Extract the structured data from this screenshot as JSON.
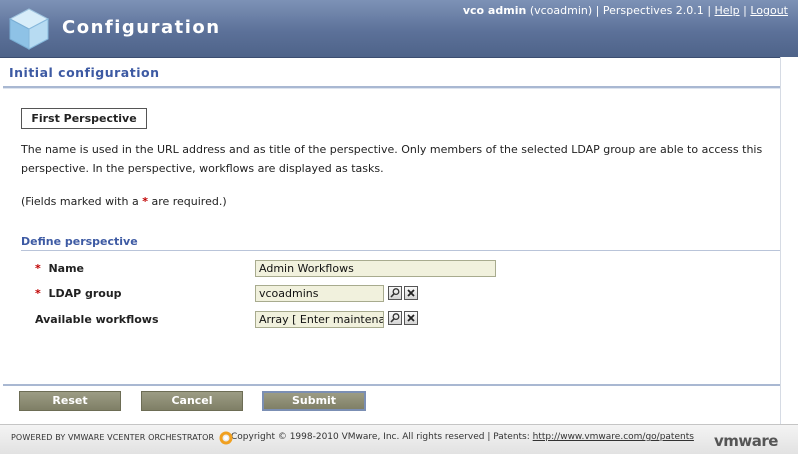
{
  "header": {
    "app_title": "Configuration",
    "user_display": "vco admin",
    "user_id": "(vcoadmin)",
    "separator": "|",
    "version_text": "Perspectives 2.0.1",
    "help_link": "Help",
    "logout_link": "Logout"
  },
  "section": {
    "title": "Initial configuration"
  },
  "tab": {
    "label": "First Perspective"
  },
  "description": "The name is used in the URL address and as title of the perspective. Only members of the selected LDAP group are able to access this perspective. In the perspective, workflows are displayed as tasks.",
  "required_note": {
    "prefix": "(Fields marked with a ",
    "star": "*",
    "suffix": " are required.)"
  },
  "define_perspective": {
    "title": "Define perspective",
    "fields": {
      "name": {
        "required_star": "*",
        "label": "Name",
        "value": "Admin Workflows"
      },
      "ldap_group": {
        "required_star": "*",
        "label": "LDAP group",
        "value": "vcoadmins"
      },
      "workflows": {
        "label": "Available workflows",
        "value": "Array [ Enter maintenance"
      }
    }
  },
  "buttons": {
    "reset": "Reset",
    "cancel": "Cancel",
    "submit": "Submit"
  },
  "footer": {
    "powered_by": "POWERED BY VMWARE VCENTER ORCHESTRATOR",
    "copyright": "Copyright © 1998-2010 VMware, Inc. All rights reserved | Patents: ",
    "patents_url": "http://www.vmware.com/go/patents",
    "brand": "vmware"
  },
  "colors": {
    "header_bg": "#5c7199",
    "section_title": "#3d5aa3",
    "required_star": "#c00000",
    "button_bg": "#8f8f76",
    "input_bg": "#f1f1dd"
  }
}
